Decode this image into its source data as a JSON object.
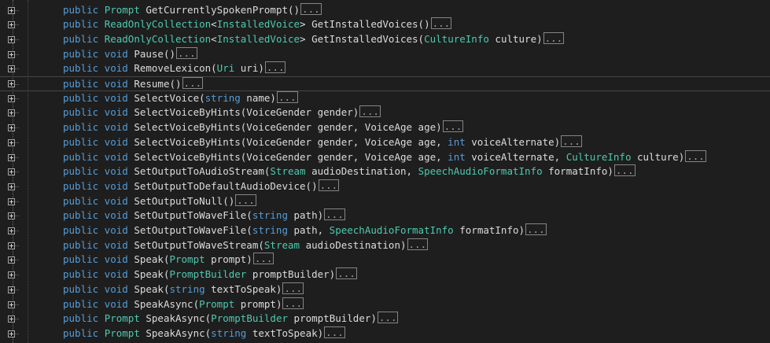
{
  "editor": {
    "collapsed_marker": "...",
    "current_line_index": 5,
    "colors": {
      "keyword": "#569cd6",
      "type": "#4ec9b0",
      "text": "#dcdcdc",
      "background": "#1e1e1e"
    },
    "lines": [
      {
        "tokens": [
          {
            "t": "kw",
            "v": "public "
          },
          {
            "t": "type",
            "v": "Prompt "
          },
          {
            "t": "plain",
            "v": "GetCurrentlySpokenPrompt()"
          }
        ]
      },
      {
        "tokens": [
          {
            "t": "kw",
            "v": "public "
          },
          {
            "t": "type",
            "v": "ReadOnlyCollection"
          },
          {
            "t": "plain",
            "v": "<"
          },
          {
            "t": "type",
            "v": "InstalledVoice"
          },
          {
            "t": "plain",
            "v": "> GetInstalledVoices()"
          }
        ]
      },
      {
        "tokens": [
          {
            "t": "kw",
            "v": "public "
          },
          {
            "t": "type",
            "v": "ReadOnlyCollection"
          },
          {
            "t": "plain",
            "v": "<"
          },
          {
            "t": "type",
            "v": "InstalledVoice"
          },
          {
            "t": "plain",
            "v": "> GetInstalledVoices("
          },
          {
            "t": "type",
            "v": "CultureInfo"
          },
          {
            "t": "plain",
            "v": " culture)"
          }
        ]
      },
      {
        "tokens": [
          {
            "t": "kw",
            "v": "public void "
          },
          {
            "t": "plain",
            "v": "Pause()"
          }
        ]
      },
      {
        "tokens": [
          {
            "t": "kw",
            "v": "public void "
          },
          {
            "t": "plain",
            "v": "RemoveLexicon("
          },
          {
            "t": "type",
            "v": "Uri"
          },
          {
            "t": "plain",
            "v": " uri)"
          }
        ]
      },
      {
        "tokens": [
          {
            "t": "kw",
            "v": "public void "
          },
          {
            "t": "plain",
            "v": "Resume()"
          }
        ]
      },
      {
        "tokens": [
          {
            "t": "kw",
            "v": "public void "
          },
          {
            "t": "plain",
            "v": "SelectVoice("
          },
          {
            "t": "kw",
            "v": "string"
          },
          {
            "t": "plain",
            "v": " name)"
          }
        ]
      },
      {
        "tokens": [
          {
            "t": "kw",
            "v": "public void "
          },
          {
            "t": "plain",
            "v": "SelectVoiceByHints(VoiceGender gender)"
          }
        ]
      },
      {
        "tokens": [
          {
            "t": "kw",
            "v": "public void "
          },
          {
            "t": "plain",
            "v": "SelectVoiceByHints(VoiceGender gender, VoiceAge age)"
          }
        ]
      },
      {
        "tokens": [
          {
            "t": "kw",
            "v": "public void "
          },
          {
            "t": "plain",
            "v": "SelectVoiceByHints(VoiceGender gender, VoiceAge age, "
          },
          {
            "t": "kw",
            "v": "int"
          },
          {
            "t": "plain",
            "v": " voiceAlternate)"
          }
        ]
      },
      {
        "tokens": [
          {
            "t": "kw",
            "v": "public void "
          },
          {
            "t": "plain",
            "v": "SelectVoiceByHints(VoiceGender gender, VoiceAge age, "
          },
          {
            "t": "kw",
            "v": "int"
          },
          {
            "t": "plain",
            "v": " voiceAlternate, "
          },
          {
            "t": "type",
            "v": "CultureInfo"
          },
          {
            "t": "plain",
            "v": " culture)"
          }
        ]
      },
      {
        "tokens": [
          {
            "t": "kw",
            "v": "public void "
          },
          {
            "t": "plain",
            "v": "SetOutputToAudioStream("
          },
          {
            "t": "type",
            "v": "Stream"
          },
          {
            "t": "plain",
            "v": " audioDestination, "
          },
          {
            "t": "type",
            "v": "SpeechAudioFormatInfo"
          },
          {
            "t": "plain",
            "v": " formatInfo)"
          }
        ]
      },
      {
        "tokens": [
          {
            "t": "kw",
            "v": "public void "
          },
          {
            "t": "plain",
            "v": "SetOutputToDefaultAudioDevice()"
          }
        ]
      },
      {
        "tokens": [
          {
            "t": "kw",
            "v": "public void "
          },
          {
            "t": "plain",
            "v": "SetOutputToNull()"
          }
        ]
      },
      {
        "tokens": [
          {
            "t": "kw",
            "v": "public void "
          },
          {
            "t": "plain",
            "v": "SetOutputToWaveFile("
          },
          {
            "t": "kw",
            "v": "string"
          },
          {
            "t": "plain",
            "v": " path)"
          }
        ]
      },
      {
        "tokens": [
          {
            "t": "kw",
            "v": "public void "
          },
          {
            "t": "plain",
            "v": "SetOutputToWaveFile("
          },
          {
            "t": "kw",
            "v": "string"
          },
          {
            "t": "plain",
            "v": " path, "
          },
          {
            "t": "type",
            "v": "SpeechAudioFormatInfo"
          },
          {
            "t": "plain",
            "v": " formatInfo)"
          }
        ]
      },
      {
        "tokens": [
          {
            "t": "kw",
            "v": "public void "
          },
          {
            "t": "plain",
            "v": "SetOutputToWaveStream("
          },
          {
            "t": "type",
            "v": "Stream"
          },
          {
            "t": "plain",
            "v": " audioDestination)"
          }
        ]
      },
      {
        "tokens": [
          {
            "t": "kw",
            "v": "public void "
          },
          {
            "t": "plain",
            "v": "Speak("
          },
          {
            "t": "type",
            "v": "Prompt"
          },
          {
            "t": "plain",
            "v": " prompt)"
          }
        ]
      },
      {
        "tokens": [
          {
            "t": "kw",
            "v": "public void "
          },
          {
            "t": "plain",
            "v": "Speak("
          },
          {
            "t": "type",
            "v": "PromptBuilder"
          },
          {
            "t": "plain",
            "v": " promptBuilder)"
          }
        ]
      },
      {
        "tokens": [
          {
            "t": "kw",
            "v": "public void "
          },
          {
            "t": "plain",
            "v": "Speak("
          },
          {
            "t": "kw",
            "v": "string"
          },
          {
            "t": "plain",
            "v": " textToSpeak)"
          }
        ]
      },
      {
        "tokens": [
          {
            "t": "kw",
            "v": "public void "
          },
          {
            "t": "plain",
            "v": "SpeakAsync("
          },
          {
            "t": "type",
            "v": "Prompt"
          },
          {
            "t": "plain",
            "v": " prompt)"
          }
        ]
      },
      {
        "tokens": [
          {
            "t": "kw",
            "v": "public "
          },
          {
            "t": "type",
            "v": "Prompt "
          },
          {
            "t": "plain",
            "v": "SpeakAsync("
          },
          {
            "t": "type",
            "v": "PromptBuilder"
          },
          {
            "t": "plain",
            "v": " promptBuilder)"
          }
        ]
      },
      {
        "tokens": [
          {
            "t": "kw",
            "v": "public "
          },
          {
            "t": "type",
            "v": "Prompt "
          },
          {
            "t": "plain",
            "v": "SpeakAsync("
          },
          {
            "t": "kw",
            "v": "string"
          },
          {
            "t": "plain",
            "v": " textToSpeak)"
          }
        ]
      }
    ]
  }
}
